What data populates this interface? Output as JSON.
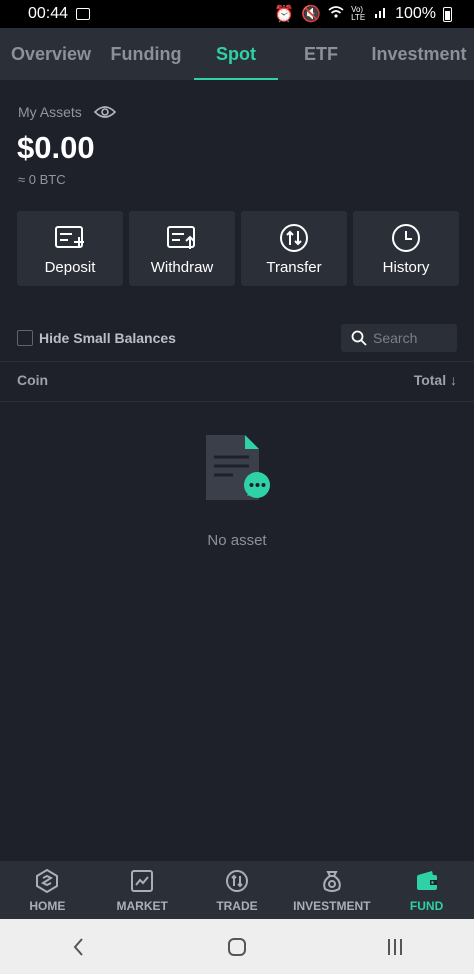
{
  "status_bar": {
    "time": "00:44",
    "signal_text": "Vo)\nLTE",
    "battery": "100%"
  },
  "tabs": [
    {
      "label": "Overview",
      "active": false
    },
    {
      "label": "Funding",
      "active": false
    },
    {
      "label": "Spot",
      "active": true
    },
    {
      "label": "ETF",
      "active": false
    },
    {
      "label": "Investment",
      "active": false
    }
  ],
  "assets": {
    "label": "My Assets",
    "value": "$0.00",
    "btc": "≈ 0 BTC"
  },
  "actions": [
    {
      "label": "Deposit",
      "icon": "deposit-icon"
    },
    {
      "label": "Withdraw",
      "icon": "withdraw-icon"
    },
    {
      "label": "Transfer",
      "icon": "transfer-icon"
    },
    {
      "label": "History",
      "icon": "history-icon"
    }
  ],
  "filter": {
    "hide_small_label": "Hide Small Balances",
    "search_placeholder": "Search"
  },
  "table": {
    "coin_header": "Coin",
    "total_header": "Total"
  },
  "empty": {
    "text": "No asset"
  },
  "bottom_nav": [
    {
      "label": "HOME",
      "icon": "home-icon",
      "active": false
    },
    {
      "label": "MARKET",
      "icon": "market-icon",
      "active": false
    },
    {
      "label": "TRADE",
      "icon": "trade-icon",
      "active": false
    },
    {
      "label": "INVESTMENT",
      "icon": "investment-icon",
      "active": false
    },
    {
      "label": "FUND",
      "icon": "wallet-icon",
      "active": true
    }
  ],
  "colors": {
    "accent": "#2fd1a6",
    "background": "#1e2129",
    "card": "#2b2f38"
  }
}
